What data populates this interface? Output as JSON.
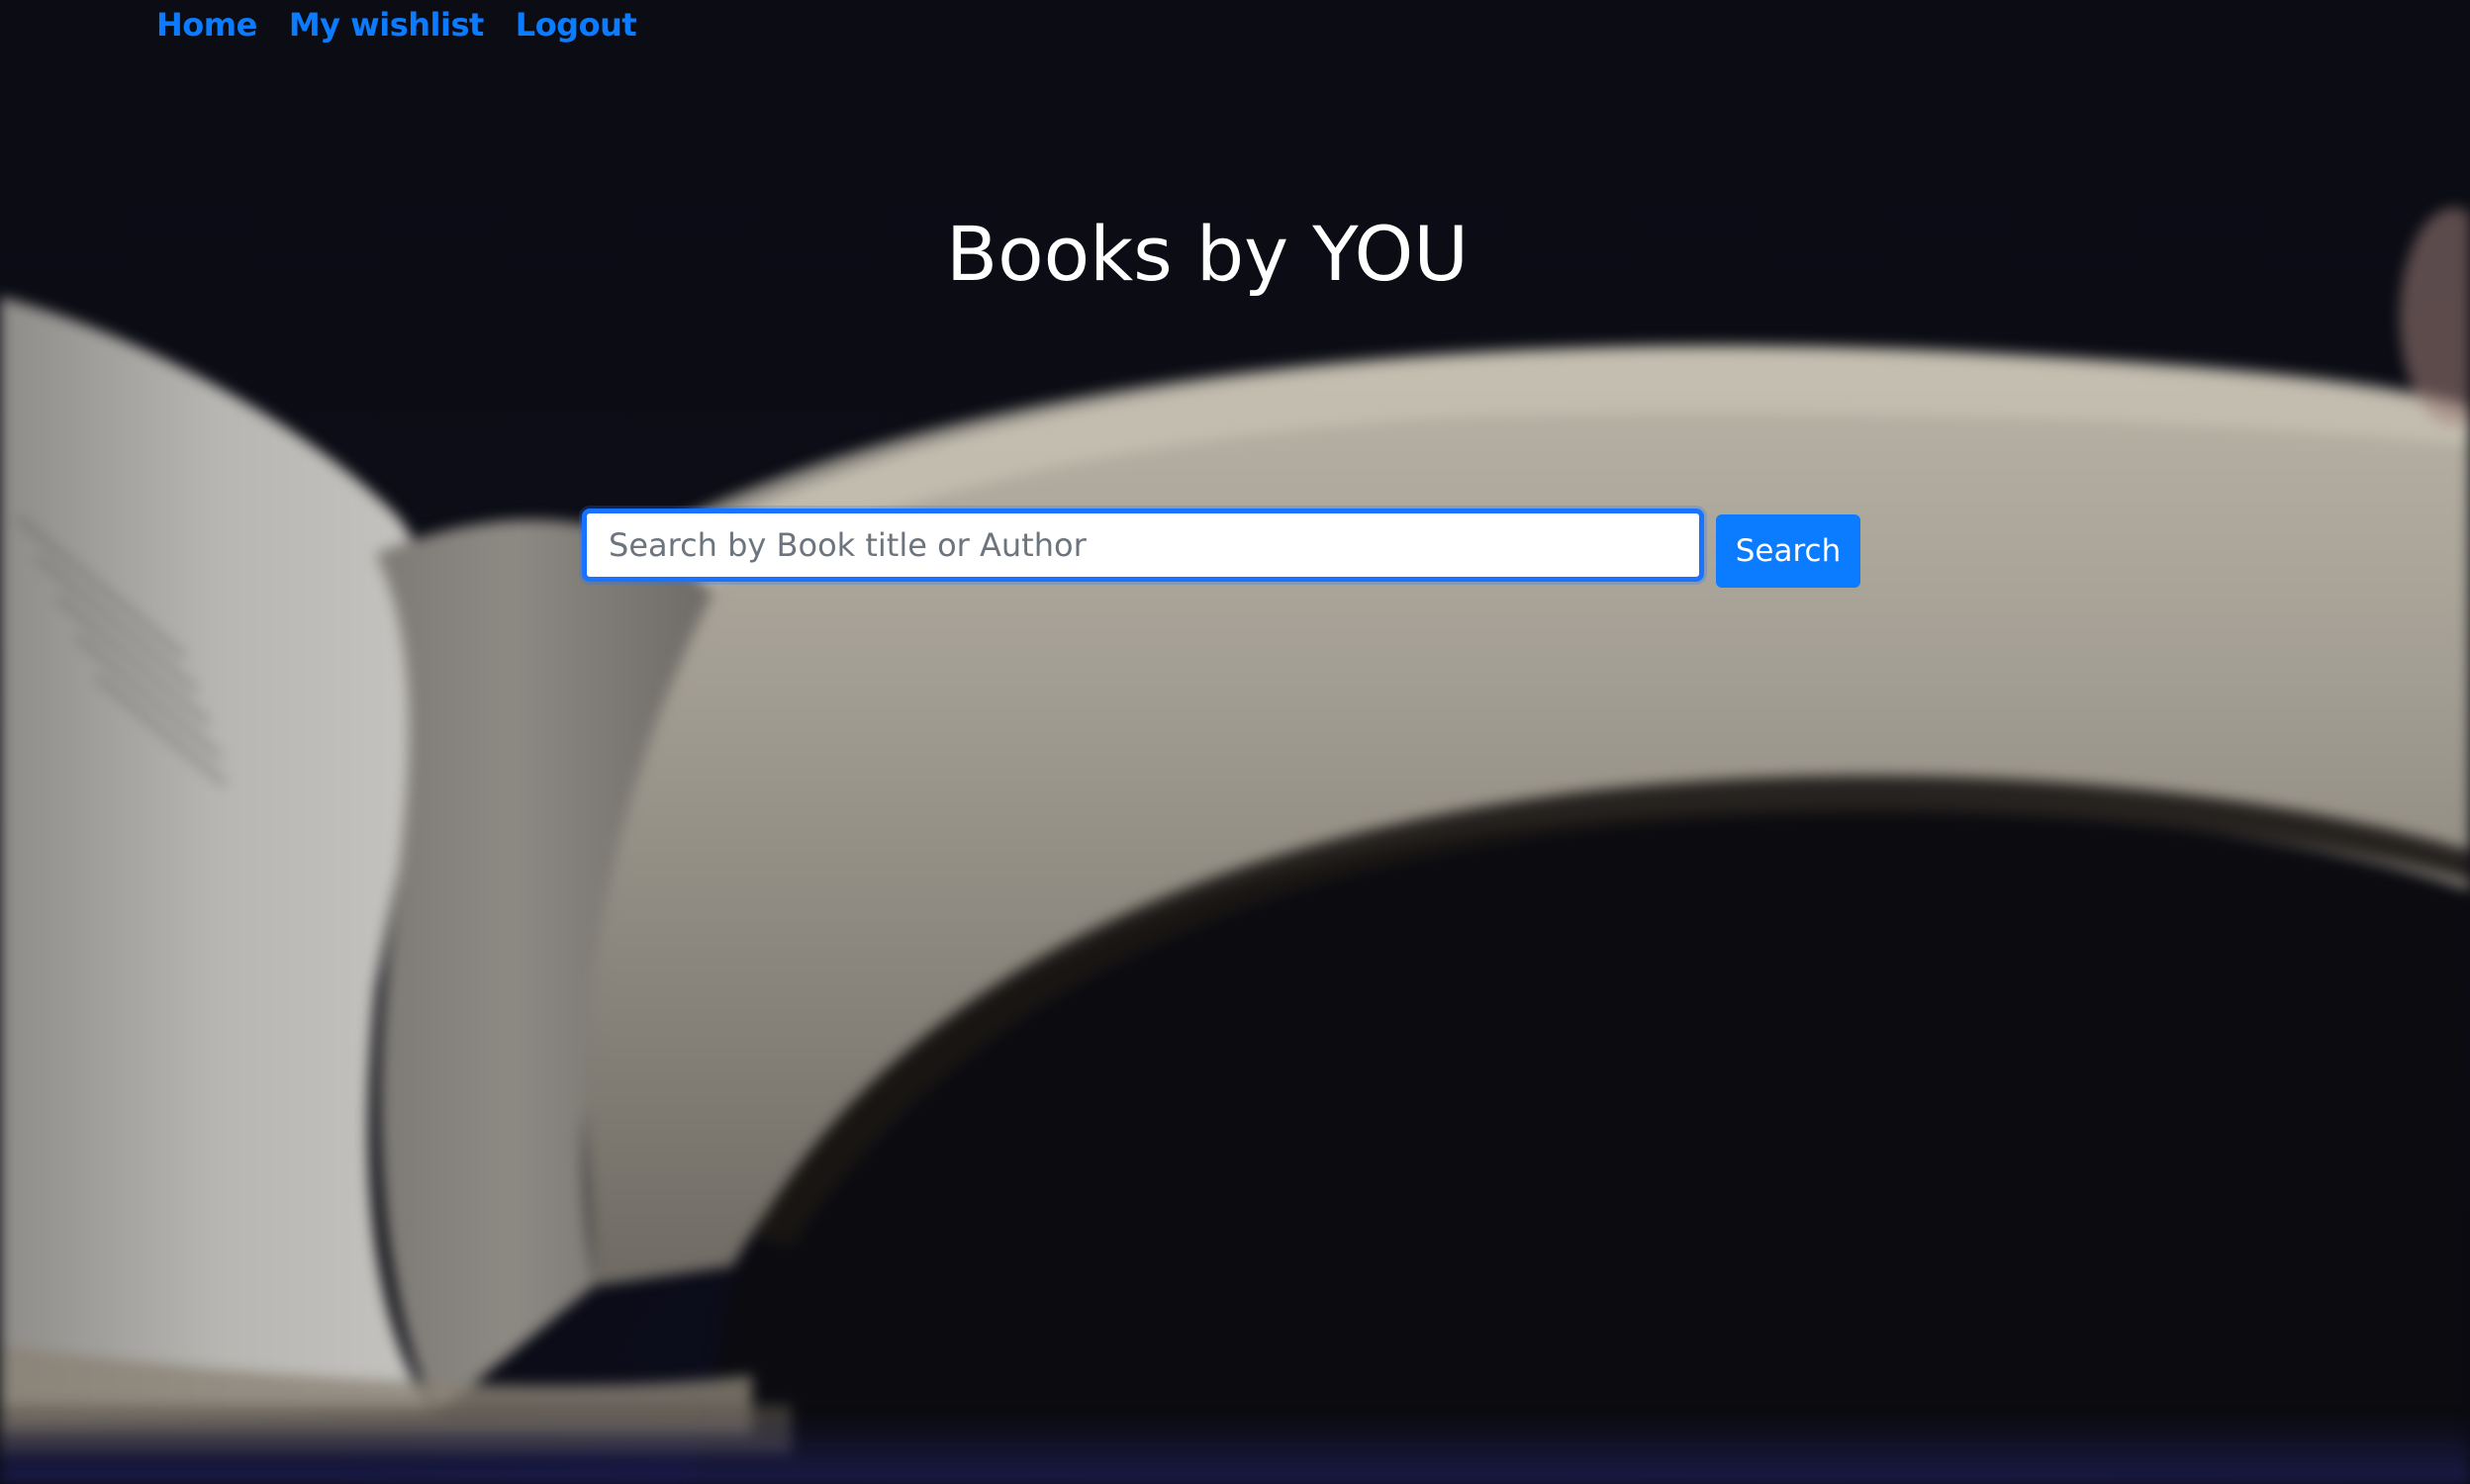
{
  "nav": {
    "items": [
      {
        "label": "Home"
      },
      {
        "label": "My wishlist"
      },
      {
        "label": "Logout"
      }
    ]
  },
  "hero": {
    "title": "Books by YOU"
  },
  "search": {
    "placeholder": "Search by Book title or Author",
    "value": "",
    "button_label": "Search"
  },
  "colors": {
    "accent": "#0b7cff",
    "background": "#0a0b12",
    "title_text": "#ffffff"
  }
}
